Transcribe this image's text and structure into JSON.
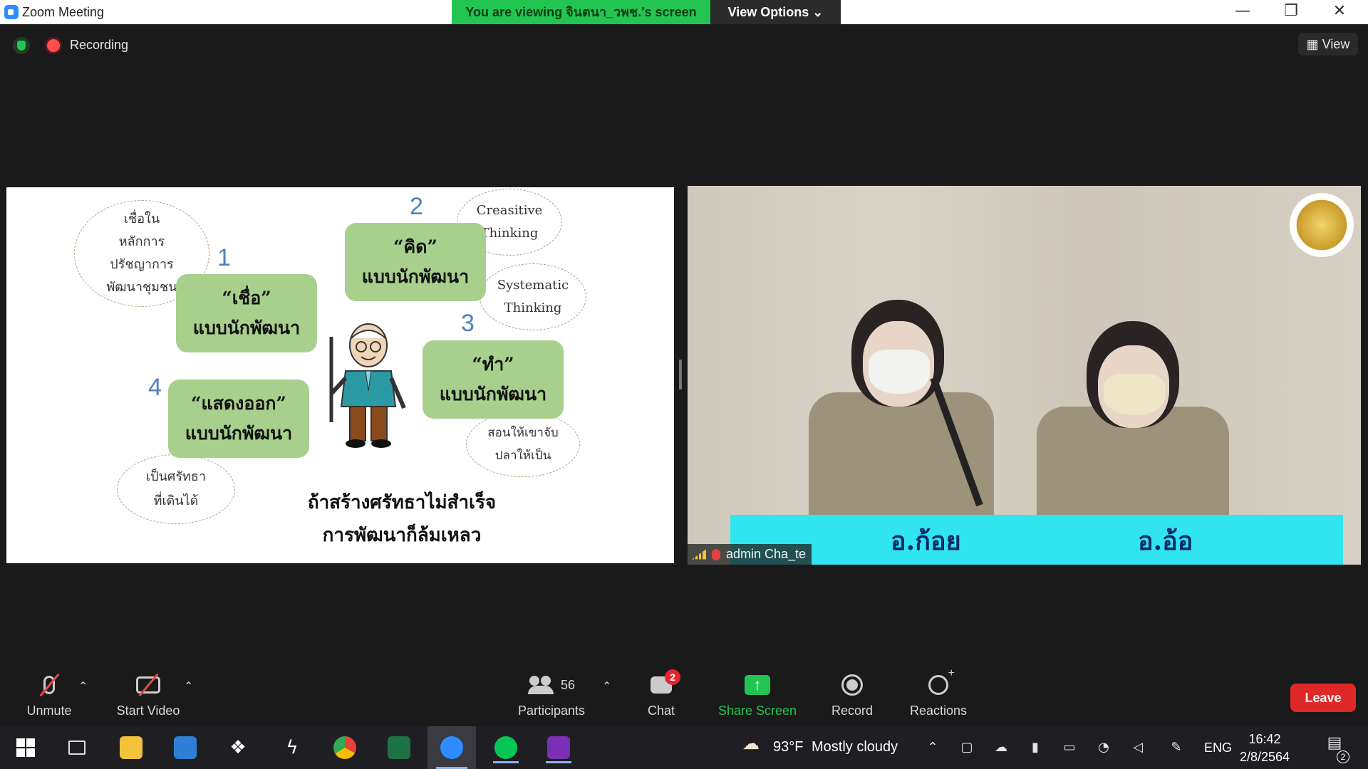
{
  "window": {
    "title": "Zoom Meeting",
    "viewing_banner": "You are viewing จินตนา_วพช.'s screen",
    "view_options": "View Options ⌄",
    "controls": {
      "minimize": "—",
      "restore": "❐",
      "close": "✕"
    }
  },
  "status": {
    "recording": "Recording",
    "view": "View"
  },
  "slide": {
    "clouds": {
      "belief": [
        "เชื่อใน",
        "หลักการ",
        "ปรัชญาการ",
        "พัฒนาชุมชน"
      ],
      "creative": [
        "Creasitive",
        "Thinking"
      ],
      "systematic": [
        "Systematic",
        "Thinking"
      ],
      "teach": [
        "สอนให้เขาจับ",
        "ปลาให้เป็น"
      ],
      "faith": [
        "เป็นศรัทธา",
        "ที่เดินได้"
      ]
    },
    "numbers": [
      "1",
      "2",
      "3",
      "4"
    ],
    "bubbles": {
      "believe": [
        "“เชื่อ”",
        "แบบนักพัฒนา"
      ],
      "think": [
        "“คิด”",
        "แบบนักพัฒนา"
      ],
      "do": [
        "“ทำ”",
        "แบบนักพัฒนา"
      ],
      "show": [
        "“แสดงออก”",
        "แบบนักพัฒนา"
      ]
    },
    "caption": [
      "ถ้าสร้างศรัทธาไม่สำเร็จ",
      "การพัฒนาก็ล้มเหลว"
    ]
  },
  "video": {
    "participant_name": "admin Cha_te",
    "name_plates": [
      "อ.ก้อย",
      "อ.อ้อ"
    ]
  },
  "toolbar": {
    "unmute": "Unmute",
    "start_video": "Start Video",
    "participants_label": "Participants",
    "participants_count": "56",
    "chat": "Chat",
    "chat_badge": "2",
    "share_screen": "Share Screen",
    "record": "Record",
    "reactions": "Reactions",
    "leave": "Leave"
  },
  "taskbar": {
    "weather_temp": "93°F",
    "weather_desc": "Mostly cloudy",
    "language": "ENG",
    "time": "16:42",
    "date": "2/8/2564",
    "notifications": "2"
  },
  "colors": {
    "accent_green": "#23c552",
    "leave_red": "#e02828",
    "bubble_green": "#a8d08d",
    "number_blue": "#4f81bd"
  }
}
